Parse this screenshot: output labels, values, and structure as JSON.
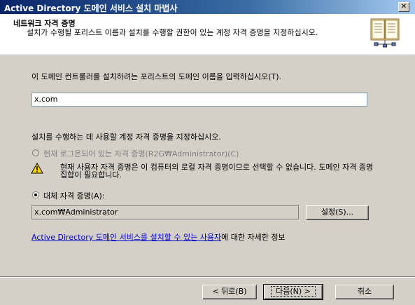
{
  "window": {
    "title": "Active Directory 도메인 서비스 설치 마법사"
  },
  "header": {
    "title": "네트워크 자격 증명",
    "description": "설치가 수행될 포리스트 이름과 설치를 수행할 권한이 있는 계정 자격 증명을 지정하십시오."
  },
  "forest": {
    "prompt": "이 도메인 컨트롤러를 설치하려는 포리스트의 도메인 이름을 입력하십시오(T).",
    "value": "x.com"
  },
  "credentials": {
    "prompt": "설치를 수행하는 데 사용할 계정 자격 증명을 지정하십시오.",
    "current_option": "현재 로그온되어 있는 자격 증명(R2G₩Administrator)(C)",
    "warning": "현재 사용자 자격 증명은 이 컴퓨터의 로컬 자격 증명이므로 선택할 수 없습니다. 도메인 자격 증명 집합이 필요합니다.",
    "alt_option": "대체 자격 증명(A):",
    "alt_value": "x.com₩Administrator",
    "set_button": "설정(S)..."
  },
  "info_link": {
    "link_text": "Active Directory 도메인 서비스를 설치할 수 있는 사용자",
    "suffix": "에 대한 자세한 정보"
  },
  "footer": {
    "back": "< 뒤로(B)",
    "next": "다음(N) >",
    "cancel": "취소"
  }
}
